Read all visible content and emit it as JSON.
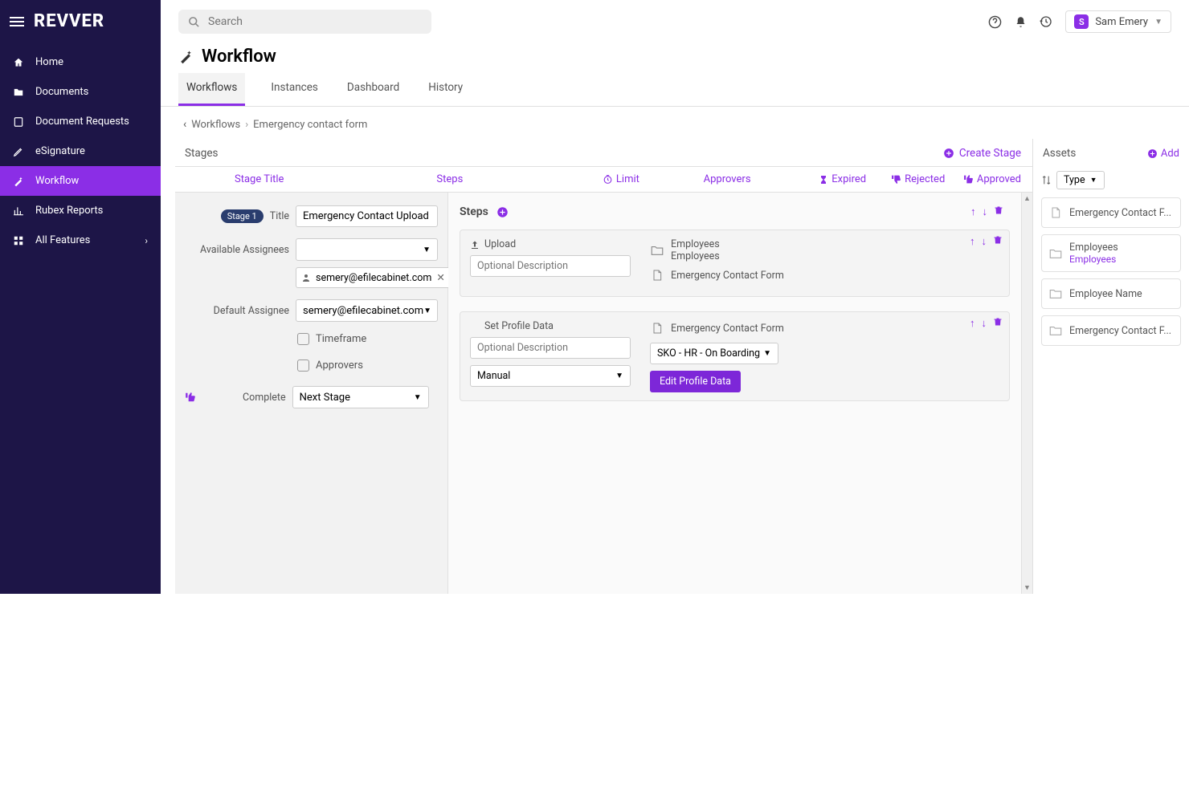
{
  "brand": "REVVER",
  "search": {
    "placeholder": "Search"
  },
  "user": {
    "name": "Sam Emery",
    "initial": "S"
  },
  "sidebar": {
    "items": [
      {
        "label": "Home",
        "icon": "home"
      },
      {
        "label": "Documents",
        "icon": "folder"
      },
      {
        "label": "Document Requests",
        "icon": "request"
      },
      {
        "label": "eSignature",
        "icon": "pen"
      },
      {
        "label": "Workflow",
        "icon": "wand",
        "active": true
      },
      {
        "label": "Rubex Reports",
        "icon": "chart"
      },
      {
        "label": "All Features",
        "icon": "grid",
        "chevron": true
      }
    ]
  },
  "page": {
    "title": "Workflow",
    "tabs": [
      {
        "label": "Workflows",
        "active": true
      },
      {
        "label": "Instances"
      },
      {
        "label": "Dashboard"
      },
      {
        "label": "History"
      }
    ]
  },
  "breadcrumb": {
    "back": "Workflows",
    "current": "Emergency contact form"
  },
  "workflow": {
    "panel_title": "Stages",
    "create_label": "Create Stage",
    "columns": {
      "stage_title": "Stage Title",
      "steps": "Steps",
      "limit": "Limit",
      "approvers": "Approvers",
      "expired": "Expired",
      "rejected": "Rejected",
      "approved": "Approved"
    },
    "stage": {
      "badge": "Stage 1",
      "title_label": "Title",
      "title_value": "Emergency Contact Upload",
      "available_assignees_label": "Available Assignees",
      "assignee_chip": "semery@efilecabinet.com",
      "default_assignee_label": "Default Assignee",
      "default_assignee_value": "semery@efilecabinet.com",
      "timeframe_label": "Timeframe",
      "approvers_label": "Approvers",
      "complete_label": "Complete",
      "complete_value": "Next Stage"
    },
    "steps": {
      "header": "Steps",
      "step1": {
        "type_label": "Upload",
        "desc_placeholder": "Optional Description",
        "assets": [
          {
            "name": "Employees",
            "sub": "Employees",
            "kind": "folder"
          },
          {
            "name": "Emergency Contact Form",
            "kind": "file"
          }
        ]
      },
      "step2": {
        "type_label": "Set Profile Data",
        "desc_placeholder": "Optional Description",
        "mode": "Manual",
        "asset": "Emergency Contact Form",
        "select_value": "SKO - HR - On Boarding",
        "button": "Edit Profile Data"
      }
    }
  },
  "assets": {
    "title": "Assets",
    "add_label": "Add",
    "sort_label": "Type",
    "items": [
      {
        "name": "Emergency Contact F...",
        "kind": "file"
      },
      {
        "name": "Employees",
        "sub": "Employees",
        "kind": "folder"
      },
      {
        "name": "Employee Name",
        "kind": "folder"
      },
      {
        "name": "Emergency Contact F...",
        "kind": "folder"
      }
    ]
  }
}
